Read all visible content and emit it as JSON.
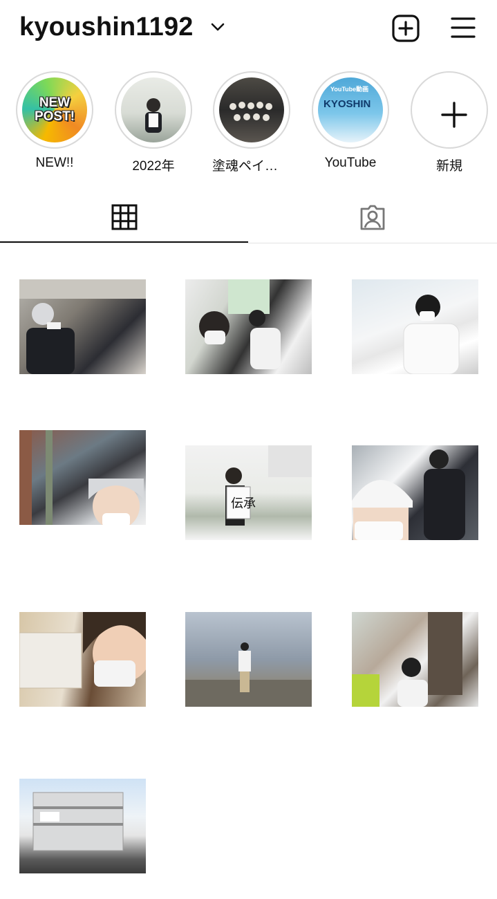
{
  "header": {
    "username": "kyoushin1192",
    "icons": {
      "dropdown": "chevron-down-icon",
      "new_post": "plus-square-icon",
      "menu": "hamburger-menu-icon"
    }
  },
  "highlights": [
    {
      "label": "NEW!!",
      "cover_text": [
        "NEW",
        "POST!"
      ]
    },
    {
      "label": "2022年"
    },
    {
      "label": "塗魂ペインタ…"
    },
    {
      "label": "YouTube",
      "cover_text": [
        "YouTube動画",
        "KYOSHIN"
      ]
    },
    {
      "label": "新規"
    }
  ],
  "tabs": [
    {
      "name": "posts",
      "icon": "grid-icon",
      "active": true
    },
    {
      "name": "tagged",
      "icon": "tagged-person-icon",
      "active": false
    }
  ],
  "posts_count_visible": 10,
  "colors": {
    "text": "#111111",
    "ring": "#d9d9d9",
    "divider": "#e3e3e3"
  }
}
